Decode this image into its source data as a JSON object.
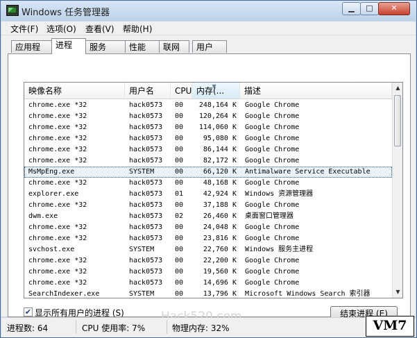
{
  "window": {
    "title": "Windows 任务管理器",
    "min_glyph": "▁",
    "max_glyph": "□",
    "close_glyph": "✕"
  },
  "menu": [
    "文件(F)",
    "选项(O)",
    "查看(V)",
    "帮助(H)"
  ],
  "tabs": [
    {
      "label": "应用程序",
      "active": false
    },
    {
      "label": "进程",
      "active": true
    },
    {
      "label": "服务",
      "active": false
    },
    {
      "label": "性能",
      "active": false
    },
    {
      "label": "联网",
      "active": false
    },
    {
      "label": "用户",
      "active": false
    }
  ],
  "columns": {
    "name": "映像名称",
    "user": "用户名",
    "cpu": "CPU",
    "memory": "内存(...",
    "description": "描述",
    "sorted": "memory",
    "sort_glyph": "▼"
  },
  "processes": [
    {
      "name": "chrome.exe *32",
      "user": "hack0573",
      "cpu": "00",
      "memory": "248,164 K",
      "description": "Google Chrome",
      "selected": false
    },
    {
      "name": "chrome.exe *32",
      "user": "hack0573",
      "cpu": "00",
      "memory": "120,264 K",
      "description": "Google Chrome",
      "selected": false
    },
    {
      "name": "chrome.exe *32",
      "user": "hack0573",
      "cpu": "00",
      "memory": "114,060 K",
      "description": "Google Chrome",
      "selected": false
    },
    {
      "name": "chrome.exe *32",
      "user": "hack0573",
      "cpu": "00",
      "memory": "95,080 K",
      "description": "Google Chrome",
      "selected": false
    },
    {
      "name": "chrome.exe *32",
      "user": "hack0573",
      "cpu": "00",
      "memory": "86,144 K",
      "description": "Google Chrome",
      "selected": false
    },
    {
      "name": "chrome.exe *32",
      "user": "hack0573",
      "cpu": "00",
      "memory": "82,172 K",
      "description": "Google Chrome",
      "selected": false
    },
    {
      "name": "MsMpEng.exe",
      "user": "SYSTEM",
      "cpu": "00",
      "memory": "66,120 K",
      "description": "Antimalware Service Executable",
      "selected": true
    },
    {
      "name": "chrome.exe *32",
      "user": "hack0573",
      "cpu": "00",
      "memory": "48,168 K",
      "description": "Google Chrome",
      "selected": false
    },
    {
      "name": "explorer.exe",
      "user": "hack0573",
      "cpu": "01",
      "memory": "42,924 K",
      "description": "Windows 资源管理器",
      "selected": false
    },
    {
      "name": "chrome.exe *32",
      "user": "hack0573",
      "cpu": "00",
      "memory": "37,188 K",
      "description": "Google Chrome",
      "selected": false
    },
    {
      "name": "dwm.exe",
      "user": "hack0573",
      "cpu": "02",
      "memory": "26,460 K",
      "description": "桌面窗口管理器",
      "selected": false
    },
    {
      "name": "chrome.exe *32",
      "user": "hack0573",
      "cpu": "00",
      "memory": "24,048 K",
      "description": "Google Chrome",
      "selected": false
    },
    {
      "name": "chrome.exe *32",
      "user": "hack0573",
      "cpu": "00",
      "memory": "23,816 K",
      "description": "Google Chrome",
      "selected": false
    },
    {
      "name": "svchost.exe",
      "user": "SYSTEM",
      "cpu": "00",
      "memory": "22,760 K",
      "description": "Windows 服务主进程",
      "selected": false
    },
    {
      "name": "chrome.exe *32",
      "user": "hack0573",
      "cpu": "00",
      "memory": "22,200 K",
      "description": "Google Chrome",
      "selected": false
    },
    {
      "name": "chrome.exe *32",
      "user": "hack0573",
      "cpu": "00",
      "memory": "19,560 K",
      "description": "Google Chrome",
      "selected": false
    },
    {
      "name": "chrome.exe *32",
      "user": "hack0573",
      "cpu": "00",
      "memory": "14,696 K",
      "description": "Google Chrome",
      "selected": false
    },
    {
      "name": "SearchIndexer.exe",
      "user": "SYSTEM",
      "cpu": "00",
      "memory": "13,796 K",
      "description": "Microsoft Windows Search 索引器",
      "selected": false
    }
  ],
  "show_all_users": {
    "label": "显示所有用户的进程 (S)",
    "checked": true,
    "check_glyph": "✔"
  },
  "end_process_button": "结束进程 (E)",
  "watermark": "Hack520.com",
  "status": {
    "processes": "进程数: 64",
    "cpu": "CPU 使用率: 7%",
    "memory": "物理内存: 32%"
  },
  "badge": "VM7"
}
